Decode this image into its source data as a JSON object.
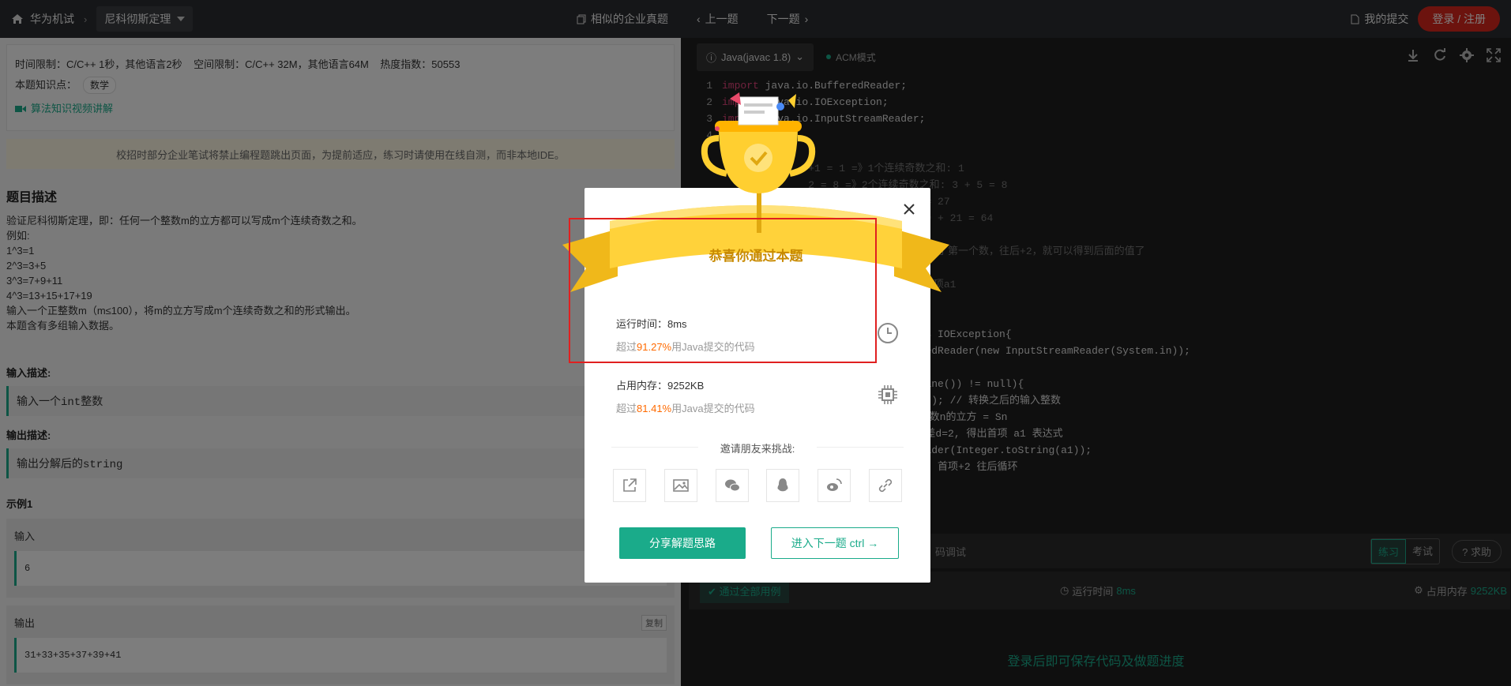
{
  "nav": {
    "brand": "华为机试",
    "problem": "尼科彻斯定理",
    "similar": "相似的企业真题",
    "prev": "上一题",
    "next": "下一题",
    "my_submit": "我的提交",
    "login": "登录 / 注册"
  },
  "problem": {
    "limits": "时间限制：C/C++ 1秒，其他语言2秒    空间限制：C/C++ 32M，其他语言64M    热度指数：50553",
    "knowledge_label": "本题知识点：",
    "knowledge_tag": "数学",
    "video_link": "算法知识视频讲解",
    "notice": "校招时部分企业笔试将禁止编程题跳出页面，为提前适应，练习时请使用在线自测，而非本地IDE。",
    "desc_title": "题目描述",
    "desc_lines": [
      "验证尼科彻斯定理，即：任何一个整数m的立方都可以写成m个连续奇数之和。",
      "例如:",
      "1^3=1",
      "2^3=3+5",
      "3^3=7+9+11",
      "4^3=13+15+17+19",
      "输入一个正整数m（m≤100），将m的立方写成m个连续奇数之和的形式输出。",
      "本题含有多组输入数据。"
    ],
    "input_title": "输入描述:",
    "input_text": "输入一个int整数",
    "output_title": "输出描述:",
    "output_text": "输出分解后的string",
    "example_title": "示例1",
    "ex_input_label": "输入",
    "ex_input": "6",
    "ex_output_label": "输出",
    "ex_copy": "复制",
    "ex_output": "31+33+35+37+39+41"
  },
  "editor": {
    "lang": "Java(javac 1.8)",
    "mode": "ACM模式",
    "lines": [
      {
        "n": "1",
        "t": "import java.io.BufferedReader;"
      },
      {
        "n": "2",
        "t": "import java.io.IOException;"
      },
      {
        "n": "3",
        "t": "import java.io.InputStreamReader;"
      },
      {
        "n": "4",
        "t": ""
      },
      {
        "n": "",
        "t": ""
      },
      {
        "n": "",
        "t": "              +1 = 1 =》1个连续奇数之和: 1"
      },
      {
        "n": "",
        "t": "              2 = 8 =》2个连续奇数之和: 3 + 5 = 8"
      },
      {
        "n": "",
        "t": "               数之和: 7 + 9 + 11 = 27"
      },
      {
        "n": "",
        "t": "               数之和: 15 + 17 + 19 + 21 = 64"
      },
      {
        "n": "",
        "t": "               2, 即公差为2, d = 2"
      },
      {
        "n": "",
        "t": "              的形式输出\"，只要我们知道了第一个数，往后+2，就可以得到后面的值了"
      },
      {
        "n": "",
        "t": "              n+[n*(n-1)*d]/2"
      },
      {
        "n": "",
        "t": "              Sn & 公差d 均已知，求首项a1"
      },
      {
        "n": "",
        "t": ""
      },
      {
        "n": "",
        "t": ""
      },
      {
        "n": "",
        "t": "              tring[] args) throws IOException{"
      },
      {
        "n": "",
        "t": "              Reader = new BufferedReader(new InputStreamReader(System.in));"
      },
      {
        "n": "",
        "t": "               \"\";"
      },
      {
        "n": "",
        "t": "               bufferReader.readLine()) != null){"
      },
      {
        "n": "",
        "t": "              arseInt(inputContent); // 转换之后的输入整数"
      },
      {
        "n": "",
        "t": "              Math.pow(n,3); // 整数n的立方 = Sn"
      },
      {
        "n": "",
        "t": "              /n - (n-1); //代入公差d=2, 得出首项 a1 表达式"
      },
      {
        "n": "",
        "t": "              ult = new StringBuilder(Integer.toString(a1));"
      },
      {
        "n": "",
        "t": "              < n; i++){ // d = 2, 首项+2 往后循环"
      }
    ],
    "debug_tab": "码调试",
    "practice": "练习",
    "exam": "考试",
    "help": "求助",
    "pass_text": "通过全部用例",
    "run_time_label": "运行时间",
    "run_time": "8ms",
    "mem_label": "占用内存",
    "mem": "9252KB",
    "save_tip": "登录后即可保存代码及做题进度"
  },
  "modal": {
    "ribbon": "恭喜你通过本题",
    "runtime_label": "运行时间：8ms",
    "runtime_prefix": "超过",
    "runtime_pct": "91.27%",
    "runtime_suffix": "用Java提交的代码",
    "mem_label": "占用内存：9252KB",
    "mem_prefix": "超过",
    "mem_pct": "81.41%",
    "mem_suffix": "用Java提交的代码",
    "invite": "邀请朋友来挑战:",
    "share_btn": "分享解题思路",
    "next_btn": "进入下一题 ctrl →",
    "share_icons": [
      "share-icon",
      "image-icon",
      "wechat-icon",
      "qq-icon",
      "weibo-icon",
      "link-icon"
    ]
  }
}
